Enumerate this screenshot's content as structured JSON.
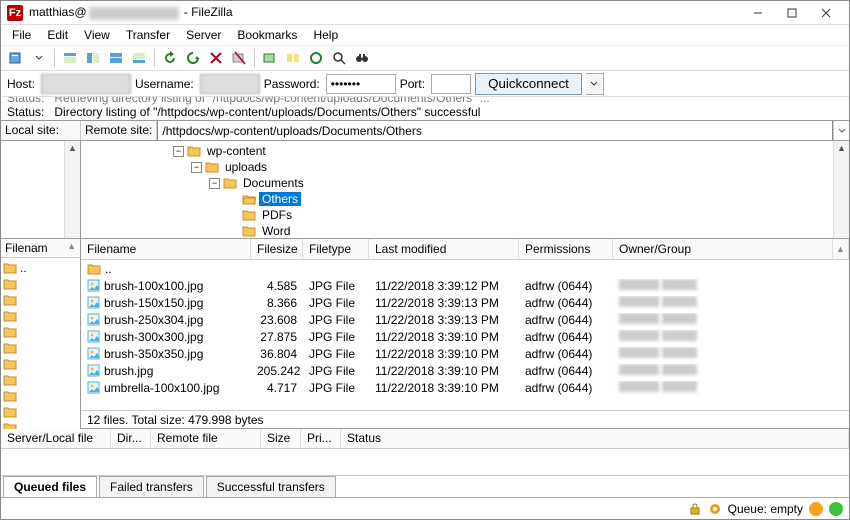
{
  "title": {
    "prefix": "matthias@",
    "app": "FileZilla",
    "sep": " - "
  },
  "menu": [
    "File",
    "Edit",
    "View",
    "Transfer",
    "Server",
    "Bookmarks",
    "Help"
  ],
  "connect": {
    "host_label": "Host:",
    "user_label": "Username:",
    "pass_label": "Password:",
    "pass_value": "•••••••",
    "port_label": "Port:",
    "port_value": "",
    "quickconnect": "Quickconnect"
  },
  "log": {
    "line1_status": "Status:",
    "line1_text": "Retrieving directory listing of \"/httpdocs/wp-content/uploads/Documents/Others\" ...",
    "line2_status": "Status:",
    "line2_text": "Directory listing of \"/httpdocs/wp-content/uploads/Documents/Others\" successful"
  },
  "path": {
    "local_label": "Local site:",
    "remote_label": "Remote site:",
    "remote_value": "/httpdocs/wp-content/uploads/Documents/Others"
  },
  "local_header": "Filenam",
  "local_updir": "..",
  "tree": {
    "n0": "wp-content",
    "n1": "uploads",
    "n2": "Documents",
    "n3": "Others",
    "n4": "PDFs",
    "n5": "Word"
  },
  "filecols": {
    "name": "Filename",
    "size": "Filesize",
    "type": "Filetype",
    "modified": "Last modified",
    "perm": "Permissions",
    "owner": "Owner/Group"
  },
  "updir": "..",
  "files": [
    {
      "name": "brush-100x100.jpg",
      "size": "4.585",
      "type": "JPG File",
      "modified": "11/22/2018 3:39:12 PM",
      "perm": "adfrw (0644)"
    },
    {
      "name": "brush-150x150.jpg",
      "size": "8.366",
      "type": "JPG File",
      "modified": "11/22/2018 3:39:13 PM",
      "perm": "adfrw (0644)"
    },
    {
      "name": "brush-250x304.jpg",
      "size": "23.608",
      "type": "JPG File",
      "modified": "11/22/2018 3:39:13 PM",
      "perm": "adfrw (0644)"
    },
    {
      "name": "brush-300x300.jpg",
      "size": "27.875",
      "type": "JPG File",
      "modified": "11/22/2018 3:39:10 PM",
      "perm": "adfrw (0644)"
    },
    {
      "name": "brush-350x350.jpg",
      "size": "36.804",
      "type": "JPG File",
      "modified": "11/22/2018 3:39:10 PM",
      "perm": "adfrw (0644)"
    },
    {
      "name": "brush.jpg",
      "size": "205.242",
      "type": "JPG File",
      "modified": "11/22/2018 3:39:10 PM",
      "perm": "adfrw (0644)"
    },
    {
      "name": "umbrella-100x100.jpg",
      "size": "4.717",
      "type": "JPG File",
      "modified": "11/22/2018 3:39:10 PM",
      "perm": "adfrw (0644)"
    }
  ],
  "filestatus": "12 files. Total size: 479.998 bytes",
  "queuecols": {
    "serverlocal": "Server/Local file",
    "dir": "Dir...",
    "remote": "Remote file",
    "size": "Size",
    "pri": "Pri...",
    "status": "Status"
  },
  "tabs": {
    "queued": "Queued files",
    "failed": "Failed transfers",
    "success": "Successful transfers"
  },
  "status": {
    "queue": "Queue: empty"
  },
  "icons": {
    "folder_color": "#f7c558",
    "folder_open_color": "#f7c558",
    "image_icon_color": "#4fb0e0"
  }
}
